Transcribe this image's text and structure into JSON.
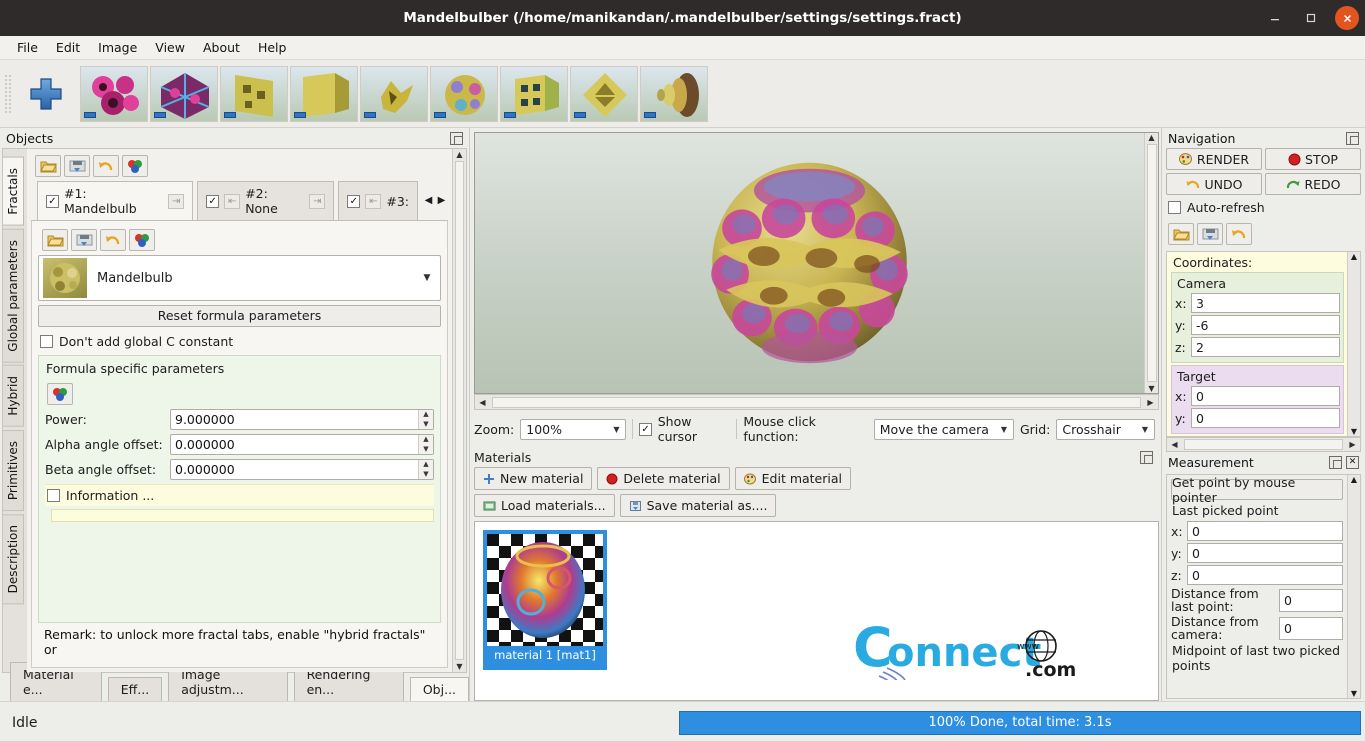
{
  "window": {
    "title": "Mandelbulber (/home/manikandan/.mandelbulber/settings/settings.fract)",
    "minimize": "—",
    "maximize": "❐",
    "close": "✕"
  },
  "menubar": {
    "items": [
      "File",
      "Edit",
      "Image",
      "View",
      "About",
      "Help"
    ]
  },
  "toolbar": {
    "add_label": "+",
    "thumbnails": [
      {
        "name": "preset-menger-pink"
      },
      {
        "name": "preset-lattice-blue"
      },
      {
        "name": "preset-box-gold"
      },
      {
        "name": "preset-cube-gold"
      },
      {
        "name": "preset-spike-gold"
      },
      {
        "name": "preset-bulb-gold"
      },
      {
        "name": "preset-cube-green"
      },
      {
        "name": "preset-octahedron-gold"
      },
      {
        "name": "preset-disc-gold"
      }
    ]
  },
  "left_dock": {
    "title": "Objects",
    "vtabs": [
      "Fractals",
      "Global parameters",
      "Hybrid",
      "Primitives",
      "Description"
    ],
    "active_vtab": "Fractals",
    "fractal_tabs": [
      {
        "label": "#1: Mandelbulb",
        "checked": "✓"
      },
      {
        "label": "#2: None",
        "checked": "✓"
      },
      {
        "label": "#3:",
        "checked": "✓"
      }
    ],
    "formula": {
      "selected": "Mandelbulb",
      "reset_button": "Reset formula parameters",
      "global_c_checkbox": "Don't add global C constant",
      "section_title": "Formula specific parameters",
      "params": [
        {
          "label": "Power:",
          "value": "9.000000"
        },
        {
          "label": "Alpha angle offset:",
          "value": "0.000000"
        },
        {
          "label": "Beta angle offset:",
          "value": "0.000000"
        }
      ],
      "information_checkbox": "Information ..."
    },
    "remark": "Remark: to unlock more fractal tabs, enable \"hybrid fractals\" or",
    "bottom_tabs": [
      {
        "label": "Material e...",
        "active": false
      },
      {
        "label": "Eff...",
        "active": false
      },
      {
        "label": "Image adjustm...",
        "active": false
      },
      {
        "label": "Rendering en...",
        "active": false
      },
      {
        "label": "Obj...",
        "active": true
      }
    ]
  },
  "center": {
    "zoom_label": "Zoom:",
    "zoom_value": "100%",
    "show_cursor_label": "Show cursor",
    "show_cursor_checked": "✓",
    "mouse_click_label": "Mouse click function:",
    "mouse_click_value": "Move the camera",
    "grid_label": "Grid:",
    "grid_value": "Crosshair",
    "materials": {
      "title": "Materials",
      "new_material": "New material",
      "delete_material": "Delete material",
      "edit_material": "Edit material",
      "load_materials": "Load materials...",
      "save_material_as": "Save material as....",
      "card_caption": "material 1 [mat1]"
    },
    "watermark": {
      "brand": "onnect",
      "letter": "C",
      "www": "www",
      "dotcom": ".com"
    }
  },
  "right_dock": {
    "navigation": {
      "title": "Navigation",
      "render": "RENDER",
      "stop": "STOP",
      "undo": "UNDO",
      "redo": "REDO",
      "auto_refresh": "Auto-refresh",
      "coordinates_title": "Coordinates:",
      "camera_title": "Camera",
      "camera": [
        {
          "label": "x:",
          "value": "3"
        },
        {
          "label": "y:",
          "value": "-6"
        },
        {
          "label": "z:",
          "value": "2"
        }
      ],
      "target_title": "Target",
      "target": [
        {
          "label": "x:",
          "value": "0"
        },
        {
          "label": "y:",
          "value": "0"
        }
      ]
    },
    "measurement": {
      "title": "Measurement",
      "get_point_button": "Get point by mouse pointer",
      "last_picked_label": "Last picked point",
      "points": [
        {
          "label": "x:",
          "value": "0"
        },
        {
          "label": "y:",
          "value": "0"
        },
        {
          "label": "z:",
          "value": "0"
        }
      ],
      "distance_last_label": "Distance from last point:",
      "distance_last_value": "0",
      "distance_camera_label": "Distance from camera:",
      "distance_camera_value": "0",
      "midpoint_label": "Midpoint of last two picked points"
    }
  },
  "statusbar": {
    "status": "Idle",
    "progress_text": "100% Done, total time: 3.1s",
    "progress_color": "#2e8fe0"
  }
}
